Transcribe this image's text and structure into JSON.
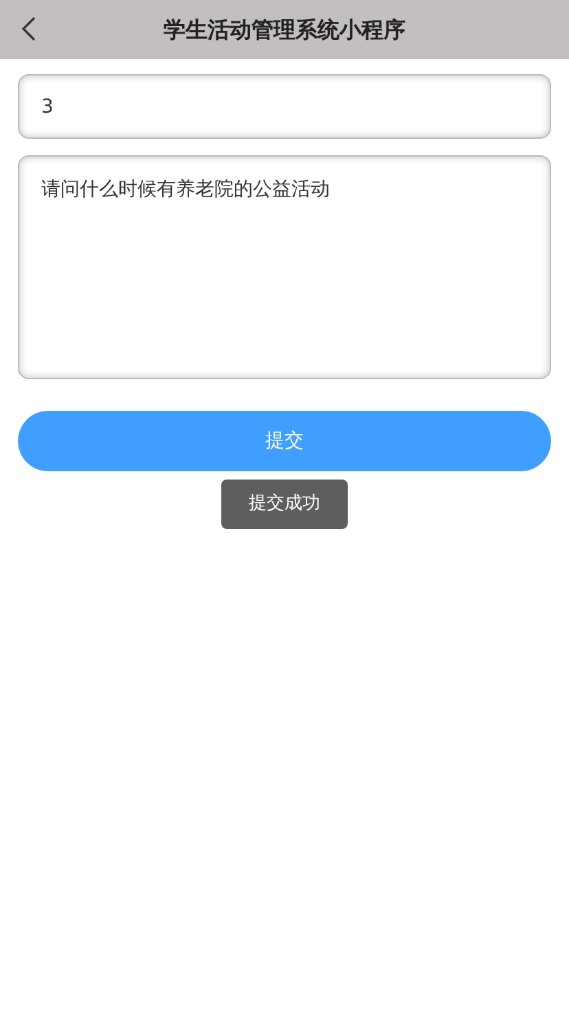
{
  "header": {
    "title": "学生活动管理系统小程序"
  },
  "form": {
    "number_field": {
      "value": "3"
    },
    "question_field": {
      "value": "请问什么时候有养老院的公益活动"
    },
    "submit_button": {
      "label": "提交"
    }
  },
  "toast": {
    "message": "提交成功"
  }
}
